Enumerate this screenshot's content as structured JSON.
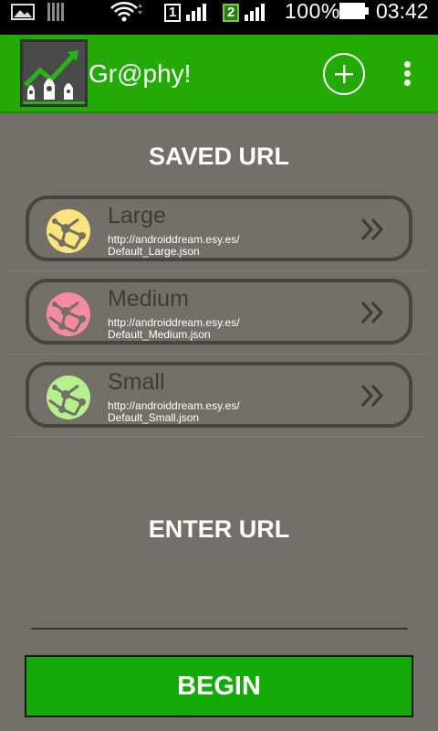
{
  "status_bar": {
    "battery": "100%",
    "time": "03:42",
    "sim1_label": "1",
    "sim2_label": "2",
    "icons": [
      "image-icon",
      "signal-bars-icon",
      "wifi-icon",
      "sim1-signal-icon",
      "sim2-signal-icon",
      "battery-icon"
    ]
  },
  "app_bar": {
    "title": "Gr@phy!",
    "add_icon": "add-circle-icon",
    "overflow_icon": "overflow-menu-icon"
  },
  "saved_section": {
    "title": "SAVED URL",
    "items": [
      {
        "name": "Large",
        "url_line1": "http://androiddream.esy.es/",
        "url_line2": "Default_Large.json",
        "globe_color": "#fbe47a"
      },
      {
        "name": "Medium",
        "url_line1": "http://androiddream.esy.es/",
        "url_line2": "Default_Medium.json",
        "globe_color": "#f68aa0"
      },
      {
        "name": "Small",
        "url_line1": "http://androiddream.esy.es/",
        "url_line2": "Default_Small.json",
        "globe_color": "#b6f08a"
      }
    ]
  },
  "enter_section": {
    "title": "ENTER URL",
    "input_value": ""
  },
  "begin_button": {
    "label": "BEGIN"
  },
  "colors": {
    "background": "#747069",
    "accent": "#24aa05",
    "button": "#15aa08"
  }
}
